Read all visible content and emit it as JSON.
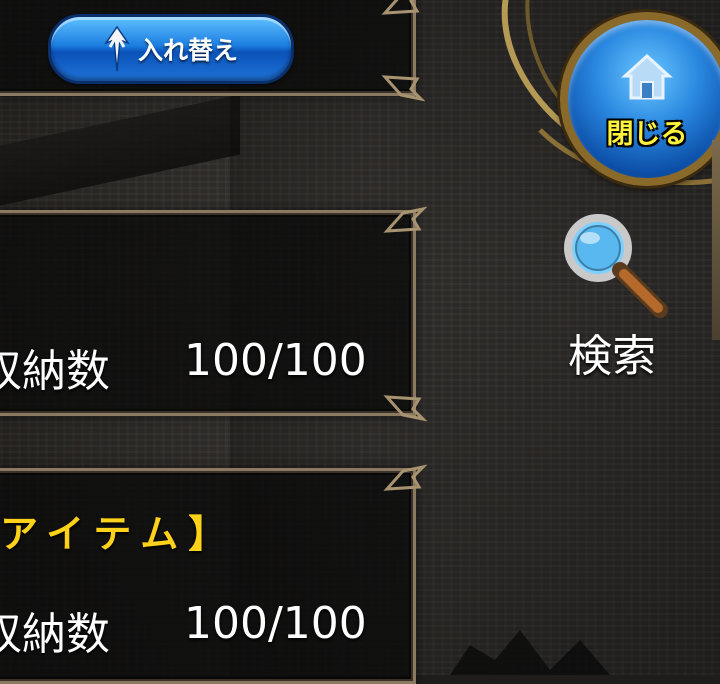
{
  "toolbar": {
    "swap_label": "入れ替え"
  },
  "close_button": {
    "label": "閉じる",
    "icon": "home-icon"
  },
  "search_button": {
    "label": "検索",
    "icon": "magnifier-icon"
  },
  "storage_panels": [
    {
      "title": "",
      "capacity_label": "収納数",
      "capacity_value": "100/100"
    },
    {
      "title": "アイテム】",
      "capacity_label": "収納数",
      "capacity_value": "100/100"
    }
  ],
  "colors": {
    "accent_blue": "#1b7de0",
    "title_yellow": "#ffd21a",
    "frame_gold": "#8b7a62"
  }
}
